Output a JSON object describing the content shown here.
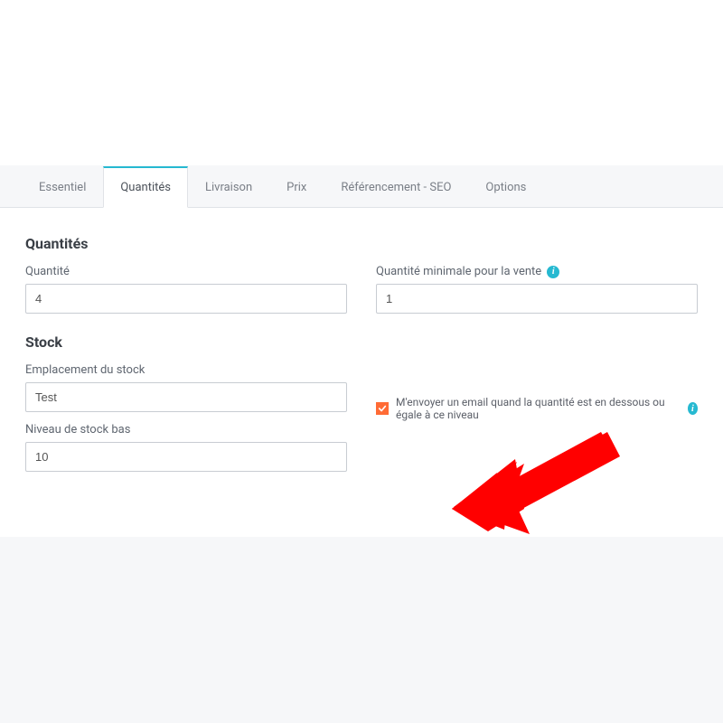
{
  "tabs": {
    "essential": "Essentiel",
    "quantities": "Quantités",
    "delivery": "Livraison",
    "price": "Prix",
    "seo": "Référencement - SEO",
    "options": "Options"
  },
  "sections": {
    "quantities_heading": "Quantités",
    "stock_heading": "Stock"
  },
  "fields": {
    "quantity_label": "Quantité",
    "quantity_value": "4",
    "min_sale_qty_label": "Quantité minimale pour la vente",
    "min_sale_qty_value": "1",
    "stock_location_label": "Emplacement du stock",
    "stock_location_value": "Test",
    "low_stock_label": "Niveau de stock bas",
    "low_stock_value": "10"
  },
  "checkbox": {
    "label": "M'envoyer un email quand la quantité est en dessous ou égale à ce niveau",
    "checked": true
  },
  "icons": {
    "info": "i"
  }
}
